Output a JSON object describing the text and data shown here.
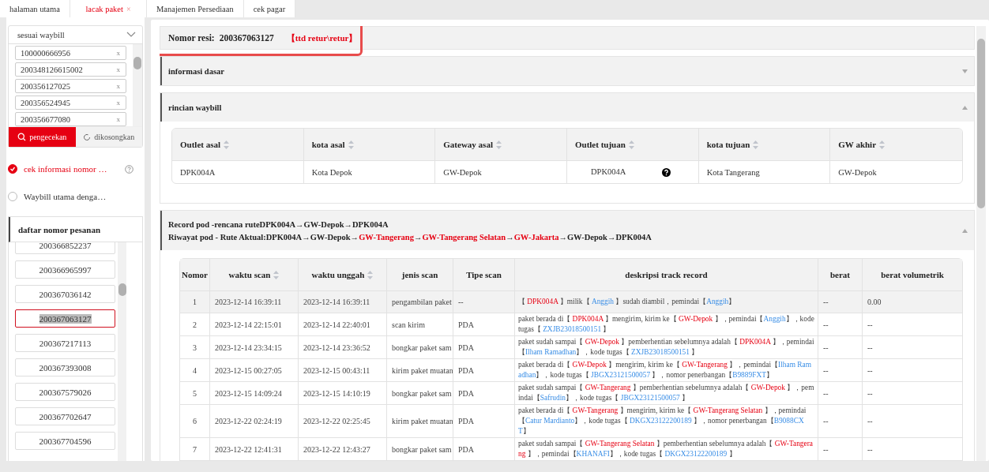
{
  "tabs": [
    {
      "label": "halaman utama",
      "selected": false,
      "closable": false
    },
    {
      "label": "lacak paket",
      "selected": true,
      "closable": true,
      "close": "×"
    },
    {
      "label": "Manajemen Persediaan",
      "selected": false,
      "closable": false
    },
    {
      "label": "cek pagar",
      "selected": false,
      "closable": false
    }
  ],
  "sidebar": {
    "search_type": "sesuai waybill",
    "waybill_inputs": [
      {
        "value": "100000666956",
        "remove": "x"
      },
      {
        "value": "200348126615002",
        "remove": "x"
      },
      {
        "value": "200356127025",
        "remove": "x"
      },
      {
        "value": "200356524945",
        "remove": "x"
      },
      {
        "value": "200356677080",
        "remove": "x"
      }
    ],
    "check_button": "pengecekan",
    "clear_button": "dikosongkan",
    "options": [
      {
        "label": "cek informasi nomor …",
        "selected": true,
        "help": true
      },
      {
        "label": "Waybill utama denga…",
        "selected": false,
        "help": false
      }
    ],
    "order_list": {
      "title": "daftar nomor pesanan",
      "items": [
        {
          "number": "200366852237",
          "selected": false
        },
        {
          "number": "200366965997",
          "selected": false
        },
        {
          "number": "200367036142",
          "selected": false
        },
        {
          "number": "200367063127",
          "selected": true
        },
        {
          "number": "200367217113",
          "selected": false
        },
        {
          "number": "200367393008",
          "selected": false
        },
        {
          "number": "200367579026",
          "selected": false
        },
        {
          "number": "200367702647",
          "selected": false
        },
        {
          "number": "200367704596",
          "selected": false
        }
      ]
    }
  },
  "header": {
    "label": "Nomor resi:",
    "number": "200367063127",
    "status": "【ttd retur\\retur】"
  },
  "sections": [
    {
      "title": "informasi dasar",
      "expanded": false
    },
    {
      "title": "rincian waybill",
      "expanded": true
    }
  ],
  "waybill_table": {
    "columns": [
      {
        "label": "Outlet asal",
        "sortable": true
      },
      {
        "label": "kota asal",
        "sortable": true
      },
      {
        "label": "Gateway asal",
        "sortable": true
      },
      {
        "label": "Outlet tujuan",
        "sortable": true
      },
      {
        "label": "kota tujuan",
        "sortable": true
      },
      {
        "label": "GW akhir",
        "sortable": true
      }
    ],
    "row": [
      {
        "text": "DPK004A",
        "help": false
      },
      {
        "text": "Kota Depok",
        "help": false
      },
      {
        "text": "GW-Depok",
        "help": false
      },
      {
        "text": "DPK004A",
        "help": true
      },
      {
        "text": "Kota Tangerang",
        "help": false
      },
      {
        "text": "GW-Depok",
        "help": false
      }
    ]
  },
  "pod": {
    "expanded": true,
    "plan_route": [
      {
        "text": "Record pod -rencana ruteDPK004A→GW-Depok→DPK004A",
        "kind": "normal"
      }
    ],
    "actual_route": [
      {
        "text": "Riwayat pod - Rute Aktual:DPK004A→GW-Depok→",
        "kind": "normal"
      },
      {
        "text": "GW-Tangerang",
        "kind": "deviation"
      },
      {
        "text": "→",
        "kind": "normal"
      },
      {
        "text": "GW-Tangerang Selatan",
        "kind": "deviation"
      },
      {
        "text": "→",
        "kind": "normal"
      },
      {
        "text": "GW-Jakarta",
        "kind": "deviation"
      },
      {
        "text": "→GW-Depok→DPK004A",
        "kind": "normal"
      }
    ],
    "columns": [
      {
        "label": "Nomor",
        "sortable": false
      },
      {
        "label": "waktu scan",
        "sortable": true
      },
      {
        "label": "waktu unggah",
        "sortable": true
      },
      {
        "label": "jenis scan",
        "sortable": false
      },
      {
        "label": "Tipe scan",
        "sortable": false
      },
      {
        "label": "deskripsi track record",
        "sortable": false
      },
      {
        "label": "berat",
        "sortable": false
      },
      {
        "label": "berat volumetrik",
        "sortable": false
      }
    ],
    "rows": [
      {
        "no": "1",
        "scan_time": "2023-12-14 16:39:11",
        "upload_time": "2023-12-14 16:39:11",
        "scan_kind": "pengambilan paket",
        "scan_type": "--",
        "weight": "--",
        "volumetric": "0.00",
        "highlighted": true,
        "description": [
          {
            "text": "【 ",
            "kind": "text"
          },
          {
            "text": "DPK004A",
            "kind": "place"
          },
          {
            "text": " 】milik【 ",
            "kind": "text"
          },
          {
            "text": "Anggih",
            "kind": "ref"
          },
          {
            "text": " 】sudah diambil，pemindai【",
            "kind": "text"
          },
          {
            "text": "Anggih",
            "kind": "ref"
          },
          {
            "text": "】",
            "kind": "text"
          }
        ]
      },
      {
        "no": "2",
        "scan_time": "2023-12-14 22:15:01",
        "upload_time": "2023-12-14 22:40:01",
        "scan_kind": "scan kirim",
        "scan_type": "PDA",
        "weight": "--",
        "volumetric": "--",
        "highlighted": false,
        "description": [
          {
            "text": "paket berada di【 ",
            "kind": "text"
          },
          {
            "text": "DPK004A",
            "kind": "place"
          },
          {
            "text": " 】mengirim, kirim ke【 ",
            "kind": "text"
          },
          {
            "text": "GW-Depok",
            "kind": "place"
          },
          {
            "text": " 】，pemindai【",
            "kind": "text"
          },
          {
            "text": "Anggih",
            "kind": "ref"
          },
          {
            "text": "】，kode tugas【 ",
            "kind": "text"
          },
          {
            "text": "ZXJB23018500151",
            "kind": "ref"
          },
          {
            "text": " 】",
            "kind": "text"
          }
        ]
      },
      {
        "no": "3",
        "scan_time": "2023-12-14 23:34:15",
        "upload_time": "2023-12-14 23:36:52",
        "scan_kind": "bongkar paket sam",
        "scan_type": "PDA",
        "weight": "--",
        "volumetric": "--",
        "highlighted": false,
        "description": [
          {
            "text": "paket sudah sampai【 ",
            "kind": "text"
          },
          {
            "text": "GW-Depok",
            "kind": "place"
          },
          {
            "text": " 】pemberhentian sebelumnya adalah【 ",
            "kind": "text"
          },
          {
            "text": "DPK004A",
            "kind": "place"
          },
          {
            "text": " 】，pemindai【",
            "kind": "text"
          },
          {
            "text": "Ilham Ramadhan",
            "kind": "ref"
          },
          {
            "text": "】，kode tugas【 ",
            "kind": "text"
          },
          {
            "text": "ZXJB23018500151",
            "kind": "ref"
          },
          {
            "text": " 】",
            "kind": "text"
          }
        ]
      },
      {
        "no": "4",
        "scan_time": "2023-12-15 00:27:05",
        "upload_time": "2023-12-15 00:43:11",
        "scan_kind": "kirim paket muatan",
        "scan_type": "PDA",
        "weight": "--",
        "volumetric": "--",
        "highlighted": false,
        "description": [
          {
            "text": "paket berada di【 ",
            "kind": "text"
          },
          {
            "text": "GW-Depok",
            "kind": "place"
          },
          {
            "text": " 】mengirim, kirim ke【 ",
            "kind": "text"
          },
          {
            "text": "GW-Tangerang",
            "kind": "place"
          },
          {
            "text": " 】，pemindai【",
            "kind": "text"
          },
          {
            "text": "Ilham Ramadhan",
            "kind": "ref"
          },
          {
            "text": "】，kode tugas【 ",
            "kind": "text"
          },
          {
            "text": "JBGX23121500057",
            "kind": "ref"
          },
          {
            "text": " 】，nomor penerbangan【",
            "kind": "text"
          },
          {
            "text": "B9889FXT",
            "kind": "ref"
          },
          {
            "text": "】",
            "kind": "text"
          }
        ]
      },
      {
        "no": "5",
        "scan_time": "2023-12-15 14:09:24",
        "upload_time": "2023-12-15 14:10:19",
        "scan_kind": "bongkar paket sam",
        "scan_type": "PDA",
        "weight": "--",
        "volumetric": "--",
        "highlighted": false,
        "description": [
          {
            "text": "paket sudah sampai【 ",
            "kind": "text"
          },
          {
            "text": "GW-Tangerang",
            "kind": "place"
          },
          {
            "text": " 】pemberhentian sebelumnya adalah【 ",
            "kind": "text"
          },
          {
            "text": "GW-Depok",
            "kind": "place"
          },
          {
            "text": " 】，pemindai【",
            "kind": "text"
          },
          {
            "text": "Safrudin",
            "kind": "ref"
          },
          {
            "text": "】，kode tugas【 ",
            "kind": "text"
          },
          {
            "text": "JBGX23121500057",
            "kind": "ref"
          },
          {
            "text": " 】",
            "kind": "text"
          }
        ]
      },
      {
        "no": "6",
        "scan_time": "2023-12-22 02:24:19",
        "upload_time": "2023-12-22 02:25:45",
        "scan_kind": "kirim paket muatan",
        "scan_type": "PDA",
        "weight": "--",
        "volumetric": "--",
        "highlighted": false,
        "description": [
          {
            "text": "paket berada di【 ",
            "kind": "text"
          },
          {
            "text": "GW-Tangerang",
            "kind": "place"
          },
          {
            "text": " 】mengirim, kirim ke【 ",
            "kind": "text"
          },
          {
            "text": "GW-Tangerang Selatan",
            "kind": "place"
          },
          {
            "text": " 】，pemindai【",
            "kind": "text"
          },
          {
            "text": "Catur Mardianto",
            "kind": "ref"
          },
          {
            "text": "】，kode tugas【 ",
            "kind": "text"
          },
          {
            "text": "DKGX23122200189",
            "kind": "ref"
          },
          {
            "text": " 】，nomor penerbangan【",
            "kind": "text"
          },
          {
            "text": "B9088CXT",
            "kind": "ref"
          },
          {
            "text": "】",
            "kind": "text"
          }
        ]
      },
      {
        "no": "7",
        "scan_time": "2023-12-22 12:41:31",
        "upload_time": "2023-12-22 12:43:27",
        "scan_kind": "bongkar paket sam",
        "scan_type": "PDA",
        "weight": "--",
        "volumetric": "--",
        "highlighted": false,
        "description": [
          {
            "text": "paket sudah sampai【 ",
            "kind": "text"
          },
          {
            "text": "GW-Tangerang Selatan",
            "kind": "place"
          },
          {
            "text": " 】pemberhentian sebelumnya adalah【 ",
            "kind": "text"
          },
          {
            "text": "GW-Tangerang",
            "kind": "place"
          },
          {
            "text": " 】，pemindai【",
            "kind": "text"
          },
          {
            "text": "KHANAFI",
            "kind": "ref"
          },
          {
            "text": "】，kode tugas【 ",
            "kind": "text"
          },
          {
            "text": "DKGX23122200189",
            "kind": "ref"
          },
          {
            "text": " 】",
            "kind": "text"
          }
        ]
      }
    ]
  }
}
